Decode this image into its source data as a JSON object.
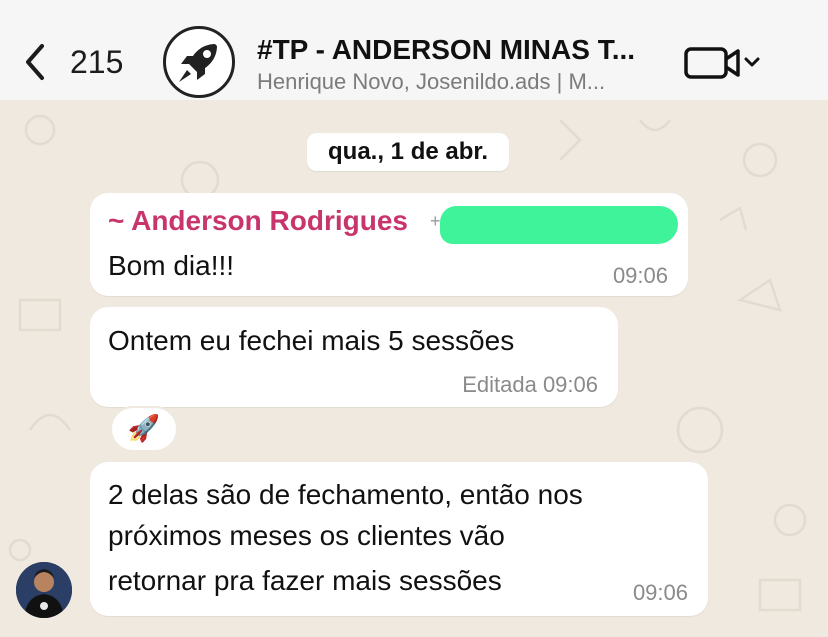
{
  "header": {
    "back_count": "215",
    "title": "#TP - ANDERSON MINAS T...",
    "subtitle": "Henrique Novo, Josenildo.ads | M..."
  },
  "chat": {
    "date_label": "qua., 1 de abr.",
    "messages": [
      {
        "sender": "~ Anderson Rodrigues",
        "text": "Bom dia!!!",
        "time": "09:06"
      },
      {
        "text": "Ontem eu fechei mais 5 sessões",
        "time": "Editada 09:06"
      },
      {
        "reaction": "🚀"
      },
      {
        "lines": [
          "2 delas são de fechamento, então nos",
          "próximos meses os clientes vão",
          "retornar pra fazer mais sessões"
        ],
        "time": "09:06"
      }
    ]
  },
  "colors": {
    "sender_name": "#c8356c",
    "redaction": "#3ff39a",
    "wallpaper": "#efe9df"
  }
}
